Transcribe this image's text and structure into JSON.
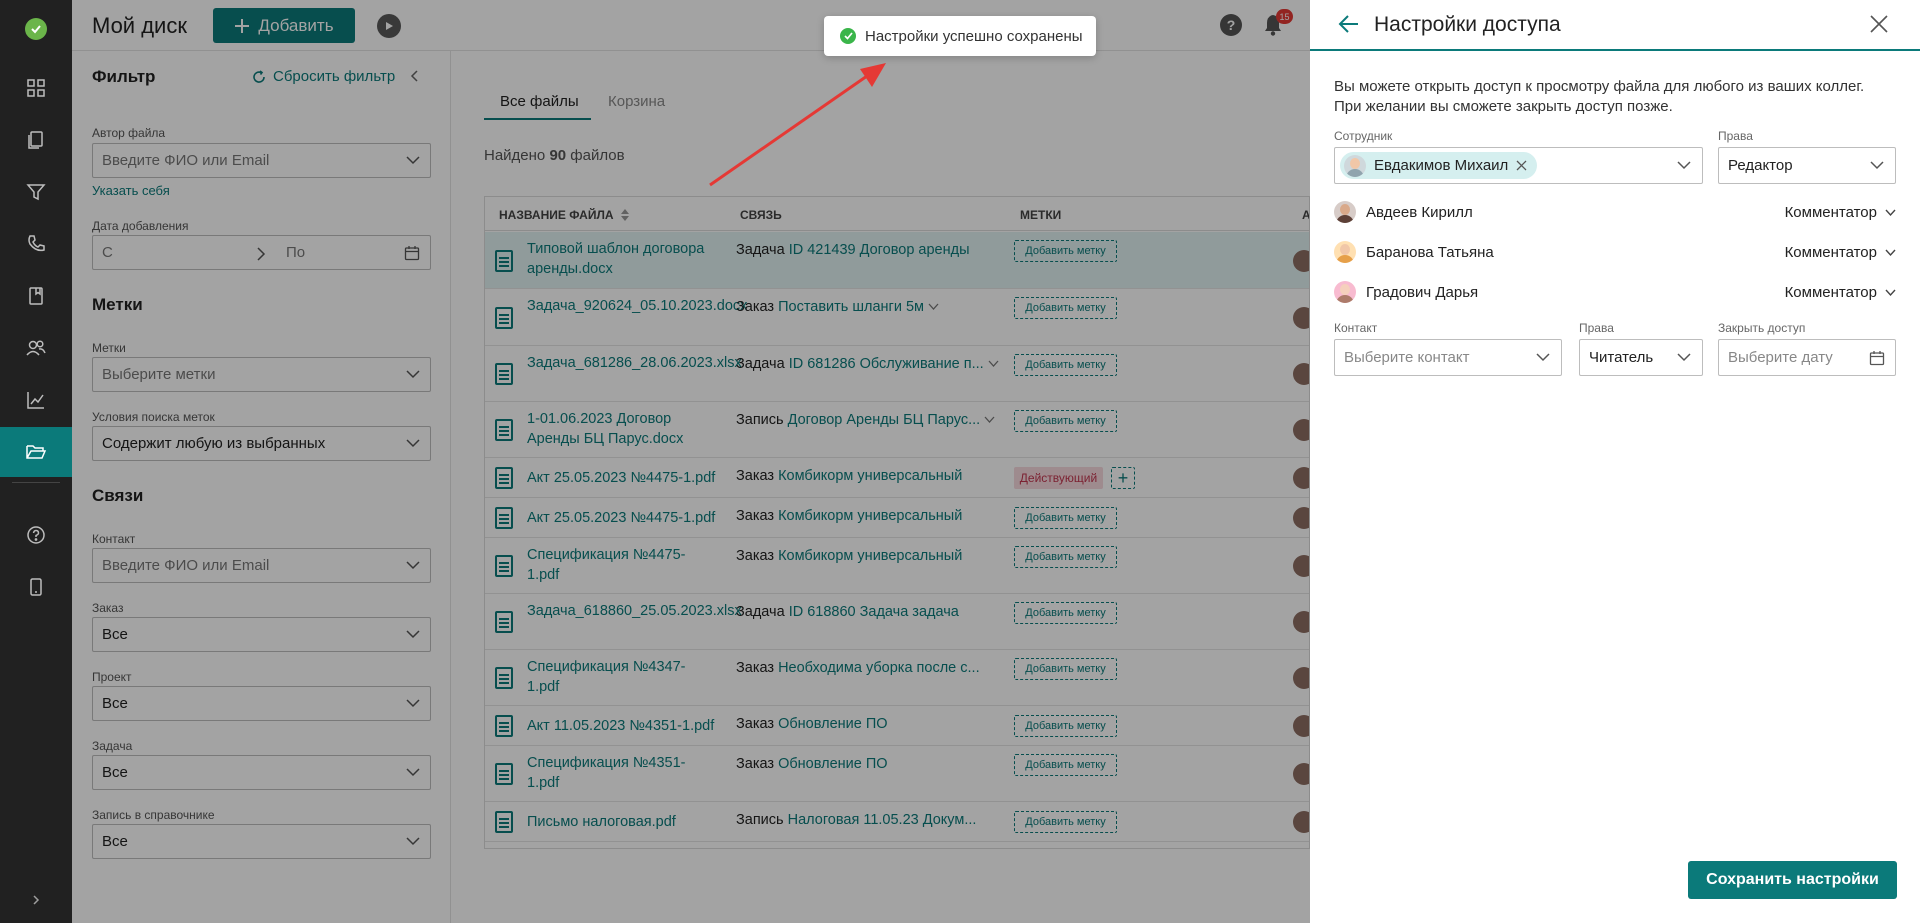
{
  "header": {
    "title": "Мой диск",
    "add_label": "Добавить",
    "notifications_count": "15",
    "help_label": "?"
  },
  "sidebar": {
    "items": [
      {
        "icon": "dashboard-icon"
      },
      {
        "icon": "documents-icon"
      },
      {
        "icon": "funnel-icon"
      },
      {
        "icon": "phone-icon"
      },
      {
        "icon": "book-icon"
      },
      {
        "icon": "users-icon"
      },
      {
        "icon": "chart-icon"
      },
      {
        "icon": "folder-icon",
        "active": true
      },
      {
        "icon": "help-circle-icon"
      },
      {
        "icon": "mobile-icon"
      }
    ]
  },
  "filter": {
    "title": "Фильтр",
    "reset": "Сбросить фильтр",
    "author_label": "Автор файла",
    "author_placeholder": "Введите ФИО или Email",
    "self_link": "Указать себя",
    "date_label": "Дата добавления",
    "date_from": "С",
    "date_to": "По",
    "tags_section": "Метки",
    "tags_label": "Метки",
    "tags_placeholder": "Выберите метки",
    "tag_condition_label": "Условия поиска меток",
    "tag_condition_value": "Содержит любую из выбранных",
    "links_section": "Связи",
    "contact_label": "Контакт",
    "contact_placeholder": "Введите ФИО или Email",
    "order_label": "Заказ",
    "order_value": "Все",
    "project_label": "Проект",
    "project_value": "Все",
    "task_label": "Задача",
    "task_value": "Все",
    "record_label": "Запись в справочнике",
    "record_value": "Все"
  },
  "main": {
    "tabs": [
      "Все файлы",
      "Корзина"
    ],
    "found_prefix": "Найдено ",
    "found_count": "90",
    "found_suffix": " файлов",
    "columns": [
      "НАЗВАНИЕ ФАЙЛА",
      "СВЯЗЬ",
      "МЕТКИ",
      "А"
    ],
    "add_tag_label": "Добавить метку",
    "rows": [
      {
        "name": "Типовой шаблон договора аренды.docx",
        "type": "Задача",
        "link": "ID 421439 Договор аренды",
        "tag": "",
        "selected": true
      },
      {
        "name": "Задача_920624_05.10.2023.docx",
        "type": "Заказ",
        "link": "Поставить шланги 5м",
        "tag": "",
        "chevron": true
      },
      {
        "name": "Задача_681286_28.06.2023.xlsx",
        "type": "Задача",
        "link": "ID 681286 Обслуживание п...",
        "tag": "",
        "chevron": true
      },
      {
        "name": "1-01.06.2023 Договор Аренды БЦ Парус.docx",
        "type": "Запись",
        "link": "Договор Аренды БЦ Парус...",
        "tag": "",
        "chevron": true
      },
      {
        "name": "Акт 25.05.2023 №4475-1.pdf",
        "type": "Заказ",
        "link": "Комбикорм универсальный",
        "tag": "Действующий"
      },
      {
        "name": "Акт 25.05.2023 №4475-1.pdf",
        "type": "Заказ",
        "link": "Комбикорм универсальный",
        "tag": ""
      },
      {
        "name": "Спецификация №4475-1.pdf",
        "type": "Заказ",
        "link": "Комбикорм универсальный",
        "tag": ""
      },
      {
        "name": "Задача_618860_25.05.2023.xlsx",
        "type": "Задача",
        "link": "ID 618860 Задача задача",
        "tag": ""
      },
      {
        "name": "Спецификация №4347-1.pdf",
        "type": "Заказ",
        "link": "Необходима уборка после с...",
        "tag": ""
      },
      {
        "name": "Акт 11.05.2023 №4351-1.pdf",
        "type": "Заказ",
        "link": "Обновление ПО",
        "tag": ""
      },
      {
        "name": "Спецификация №4351-1.pdf",
        "type": "Заказ",
        "link": "Обновление ПО",
        "tag": ""
      },
      {
        "name": "Письмо налоговая.pdf",
        "type": "Запись",
        "link": "Налоговая 11.05.23 Докум...",
        "tag": ""
      }
    ]
  },
  "toast": {
    "text": "Настройки успешно сохранены"
  },
  "panel": {
    "title": "Настройки доступа",
    "desc_line1": "Вы можете открыть доступ к просмотру файла для любого из ваших коллег.",
    "desc_line2": "При желании вы сможете закрыть доступ позже.",
    "employee_label": "Сотрудник",
    "employee_chip": "Евдакимов Михаил",
    "rights_label": "Права",
    "rights_value": "Редактор",
    "people": [
      {
        "name": "Авдеев Кирилл",
        "role": "Комментатор"
      },
      {
        "name": "Баранова Татьяна",
        "role": "Комментатор"
      },
      {
        "name": "Градович Дарья",
        "role": "Комментатор"
      }
    ],
    "contact_label": "Контакт",
    "contact_placeholder": "Выберите контакт",
    "rights2_label": "Права",
    "rights2_value": "Читатель",
    "close_access_label": "Закрыть доступ",
    "close_access_placeholder": "Выберите дату",
    "save_label": "Сохранить настройки"
  },
  "colors": {
    "accent": "#0b7a7a",
    "sidebar_bg": "#212121",
    "success": "#3ab54a",
    "badge": "#e53935",
    "tag_active_bg": "#f8d9df",
    "tag_active_text": "#c2364f"
  }
}
